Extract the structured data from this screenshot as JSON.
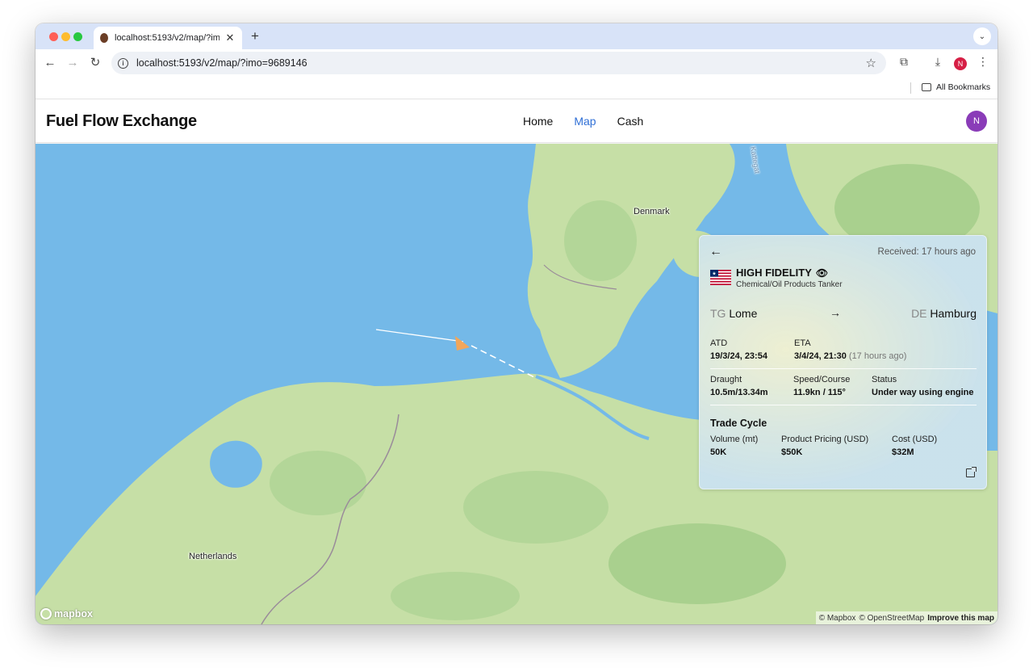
{
  "browser": {
    "tab_title": "localhost:5193/v2/map/?imo=9689146",
    "url": "localhost:5193/v2/map/?imo=9689146",
    "bookmarks_label": "All Bookmarks",
    "profile_initial": "N"
  },
  "app": {
    "brand": "Fuel Flow Exchange",
    "nav": [
      {
        "label": "Home",
        "active": false
      },
      {
        "label": "Map",
        "active": true
      },
      {
        "label": "Cash",
        "active": false
      }
    ],
    "avatar_initial": "N"
  },
  "map": {
    "labels": {
      "denmark": "Denmark",
      "netherlands": "Netherlands",
      "kattegat": "Kattegat"
    },
    "logo": "mapbox",
    "attribution": {
      "mapbox": "© Mapbox",
      "osm": "© OpenStreetMap",
      "improve": "Improve this map"
    },
    "colors": {
      "water": "#74b9e8",
      "land": "#c6dfa6",
      "forest": "#a9d08e",
      "vessel": "#f2a65a"
    }
  },
  "vessel": {
    "received": "Received: 17 hours ago",
    "name": "HIGH FIDELITY",
    "type": "Chemical/Oil Products Tanker",
    "flag": "liberia-flag",
    "origin": {
      "country_code": "TG",
      "port": "Lome"
    },
    "destination": {
      "country_code": "DE",
      "port": "Hamburg"
    },
    "atd": {
      "label": "ATD",
      "value": "19/3/24, 23:54"
    },
    "eta": {
      "label": "ETA",
      "value": "3/4/24, 21:30",
      "relative": "(17 hours ago)"
    },
    "draught": {
      "label": "Draught",
      "value": "10.5m/13.34m"
    },
    "speed_course": {
      "label": "Speed/Course",
      "value": "11.9kn / 115°"
    },
    "status": {
      "label": "Status",
      "value": "Under way using engine"
    },
    "trade_cycle": {
      "title": "Trade Cycle",
      "volume": {
        "label": "Volume (mt)",
        "value": "50K"
      },
      "pricing": {
        "label": "Product Pricing (USD)",
        "value": "$50K"
      },
      "cost": {
        "label": "Cost (USD)",
        "value": "$32M"
      }
    }
  }
}
